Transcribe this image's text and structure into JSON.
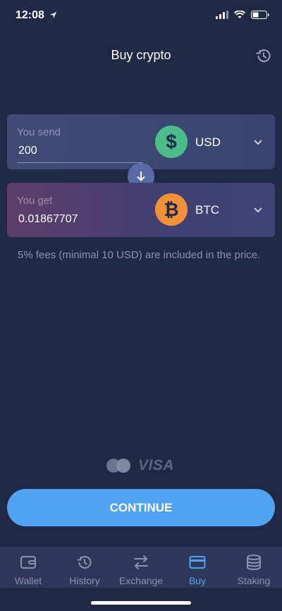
{
  "status_bar": {
    "time": "12:08"
  },
  "header": {
    "title": "Buy crypto",
    "history_icon": "history-icon"
  },
  "send": {
    "label": "You send",
    "value": "200",
    "currency": "USD",
    "coin_color": "#4cbc8a",
    "coin_icon": "dollar-icon"
  },
  "get": {
    "label": "You get",
    "value": "0.01867707",
    "currency": "BTC",
    "coin_color": "#f0913a",
    "coin_icon": "bitcoin-icon"
  },
  "fees_note": "5% fees (minimal 10 USD) are included in the price.",
  "payment": {
    "visa": "VISA"
  },
  "continue_label": "CONTINUE",
  "tabs": [
    {
      "label": "Wallet",
      "icon": "wallet-icon",
      "active": false
    },
    {
      "label": "History",
      "icon": "history-icon",
      "active": false
    },
    {
      "label": "Exchange",
      "icon": "exchange-icon",
      "active": false
    },
    {
      "label": "Buy",
      "icon": "card-icon",
      "active": true
    },
    {
      "label": "Staking",
      "icon": "staking-icon",
      "active": false
    }
  ],
  "colors": {
    "background": "#1f2845",
    "accent": "#4fa3f0",
    "tab_bar": "#2e375a"
  }
}
